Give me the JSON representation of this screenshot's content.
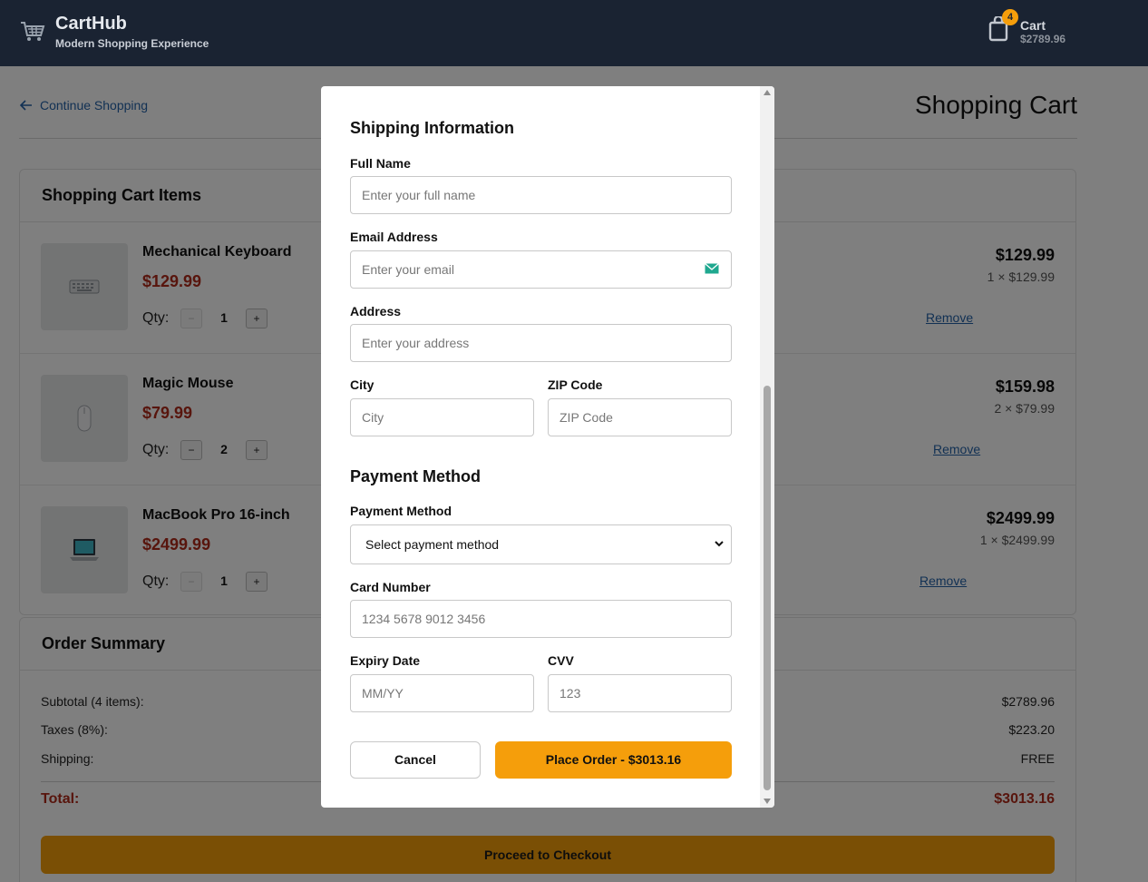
{
  "header": {
    "brand_name": "CartHub",
    "tagline": "Modern Shopping Experience",
    "cart_label": "Cart",
    "cart_total": "$2789.96",
    "cart_count": "4"
  },
  "page": {
    "continue_label": "Continue Shopping",
    "title": "Shopping Cart"
  },
  "cart_items": {
    "heading": "Shopping Cart Items",
    "items": [
      {
        "name": "Mechanical Keyboard",
        "price": "$129.99",
        "qty_label": "Qty:",
        "qty": "1",
        "minus": "−",
        "plus": "+",
        "line_total": "$129.99",
        "line_detail": "1 × $129.99",
        "remove": "Remove",
        "icon": "keyboard-icon"
      },
      {
        "name": "Magic Mouse",
        "price": "$79.99",
        "qty_label": "Qty:",
        "qty": "2",
        "minus": "−",
        "plus": "+",
        "line_total": "$159.98",
        "line_detail": "2 × $79.99",
        "remove": "Remove",
        "icon": "mouse-icon"
      },
      {
        "name": "MacBook Pro 16-inch",
        "price": "$2499.99",
        "qty_label": "Qty:",
        "qty": "1",
        "minus": "−",
        "plus": "+",
        "line_total": "$2499.99",
        "line_detail": "1 × $2499.99",
        "remove": "Remove",
        "icon": "laptop-icon"
      }
    ]
  },
  "summary": {
    "heading": "Order Summary",
    "subtotal_label": "Subtotal (4 items):",
    "subtotal": "$2789.96",
    "taxes_label": "Taxes (8%):",
    "taxes": "$223.20",
    "shipping_label": "Shipping:",
    "shipping": "FREE",
    "total_label": "Total:",
    "total": "$3013.16",
    "checkout_label": "Proceed to Checkout"
  },
  "modal": {
    "shipping_title": "Shipping Information",
    "full_name_label": "Full Name",
    "full_name_placeholder": "Enter your full name",
    "email_label": "Email Address",
    "email_placeholder": "Enter your email",
    "address_label": "Address",
    "address_placeholder": "Enter your address",
    "city_label": "City",
    "city_placeholder": "City",
    "zip_label": "ZIP Code",
    "zip_placeholder": "ZIP Code",
    "payment_title": "Payment Method",
    "payment_label": "Payment Method",
    "payment_selected": "Select payment method",
    "card_label": "Card Number",
    "card_placeholder": "1234 5678 9012 3456",
    "expiry_label": "Expiry Date",
    "expiry_placeholder": "MM/YY",
    "cvv_label": "CVV",
    "cvv_placeholder": "123",
    "cancel_label": "Cancel",
    "place_order_label": "Place Order - $3013.16"
  },
  "colors": {
    "header_bg": "#1a2332",
    "accent": "#f59e0b",
    "price_red": "#b02a1a",
    "link_blue": "#2563a8"
  }
}
